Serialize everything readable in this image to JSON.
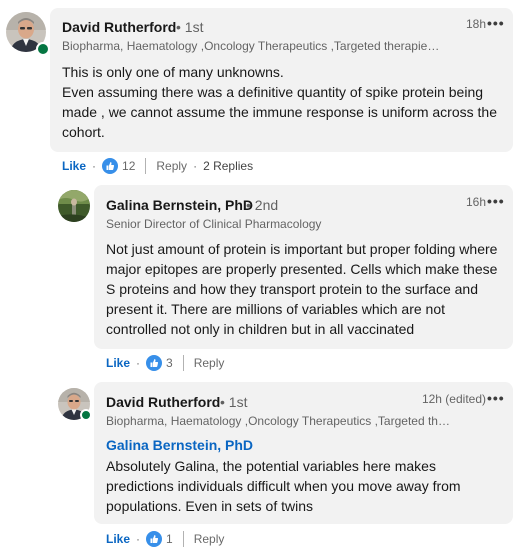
{
  "comments": [
    {
      "author": "David Rutherford",
      "degree": "• 1st",
      "headline": "Biopharma, Haematology ,Oncology Therapeutics ,Targeted therapies ...",
      "time": "18h",
      "more": "•••",
      "body": [
        "This is only one of many unknowns.",
        "Even assuming there was a definitive quantity of spike protein being made , we cannot assume the immune response is uniform across the cohort."
      ],
      "like_label": "Like",
      "reaction_count": "12",
      "reply_label": "Reply",
      "replies_label": "2 Replies"
    },
    {
      "author": "Galina Bernstein, PhD",
      "degree": "• 2nd",
      "headline": "Senior Director of Clinical Pharmacology",
      "time": "16h",
      "more": "•••",
      "body": [
        "Not just amount of protein is important but proper folding where major epitopes are properly presented. Cells which make these S proteins and how they transport protein to the surface and present it. There are millions of variables which are not controlled not only in children but in all vaccinated"
      ],
      "like_label": "Like",
      "reaction_count": "3",
      "reply_label": "Reply"
    },
    {
      "author": "David Rutherford",
      "degree": "• 1st",
      "headline": "Biopharma, Haematology ,Oncology Therapeutics ,Targeted the...",
      "time": "12h (edited)",
      "more": "•••",
      "mention": "Galina Bernstein, PhD",
      "body": [
        "Absolutely Galina, the potential variables here makes predictions individuals difficult when you move away from populations. Even in sets of twins"
      ],
      "like_label": "Like",
      "reaction_count": "1",
      "reply_label": "Reply"
    }
  ],
  "colors": {
    "bubble": "#f2f2f2",
    "link": "#0a66c2",
    "presence": "#057642"
  }
}
